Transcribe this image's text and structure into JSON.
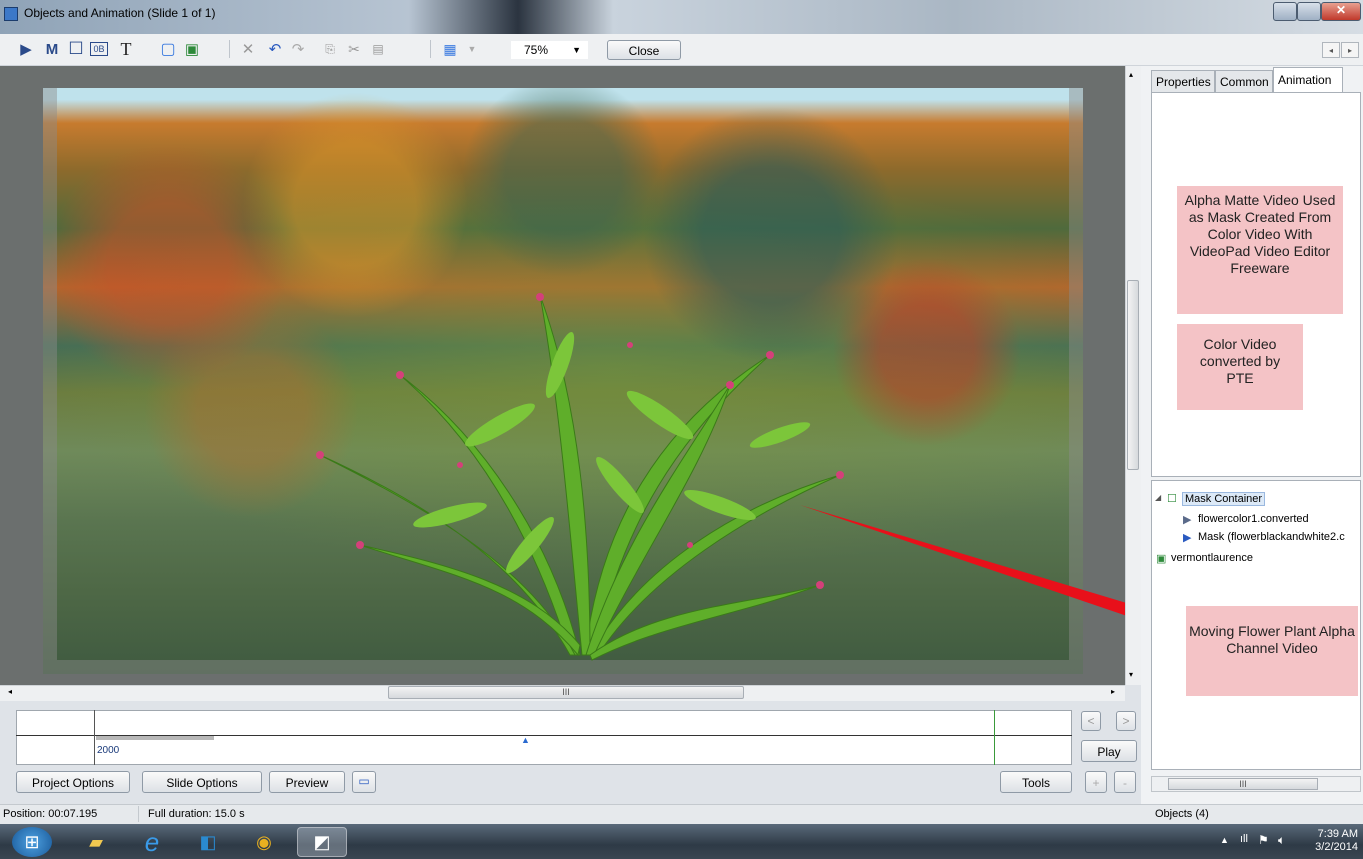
{
  "window": {
    "title": "Objects and Animation  (Slide 1 of 1)"
  },
  "toolbar": {
    "zoom_value": "75%",
    "close_label": "Close",
    "m_label": "M",
    "t_label": "T",
    "text_icon_label": "0B"
  },
  "canvas": {
    "hscroll_grip": "III"
  },
  "timeline": {
    "label": "2000"
  },
  "buttons": {
    "project_options": "Project Options",
    "slide_options": "Slide Options",
    "preview": "Preview",
    "tools": "Tools",
    "play": "Play",
    "prev": "<",
    "next": ">",
    "plus": "+",
    "minus": "-"
  },
  "status": {
    "position": "Position: 00:07.195",
    "duration": "Full duration: 15.0 s",
    "objects": "Objects (4)"
  },
  "right_panel": {
    "tabs": [
      "Properties",
      "Common",
      "Animation"
    ],
    "active_tab": "Animation",
    "tree": [
      {
        "label": "Mask Container",
        "level": 0,
        "selected": true
      },
      {
        "label": "flowercolor1.converted",
        "level": 1
      },
      {
        "label": "Mask (flowerblackandwhite2.c",
        "level": 1
      },
      {
        "label": "vermontlaurence",
        "level": 0
      }
    ],
    "hscroll_grip": "III"
  },
  "callouts": {
    "alpha_matte": "Alpha Matte Video Used as Mask Created From Color Video With VideoPad Video Editor Freeware",
    "color_video": "Color Video converted by PTE",
    "moving_flower": "Moving Flower Plant Alpha Channel Video"
  },
  "taskbar": {
    "time": "7:39 AM",
    "date": "3/2/2014"
  },
  "colors": {
    "callout_bg": "#f4c3c6",
    "arrow_red": "#e8101a",
    "tree_selection": "#dce9f7"
  }
}
